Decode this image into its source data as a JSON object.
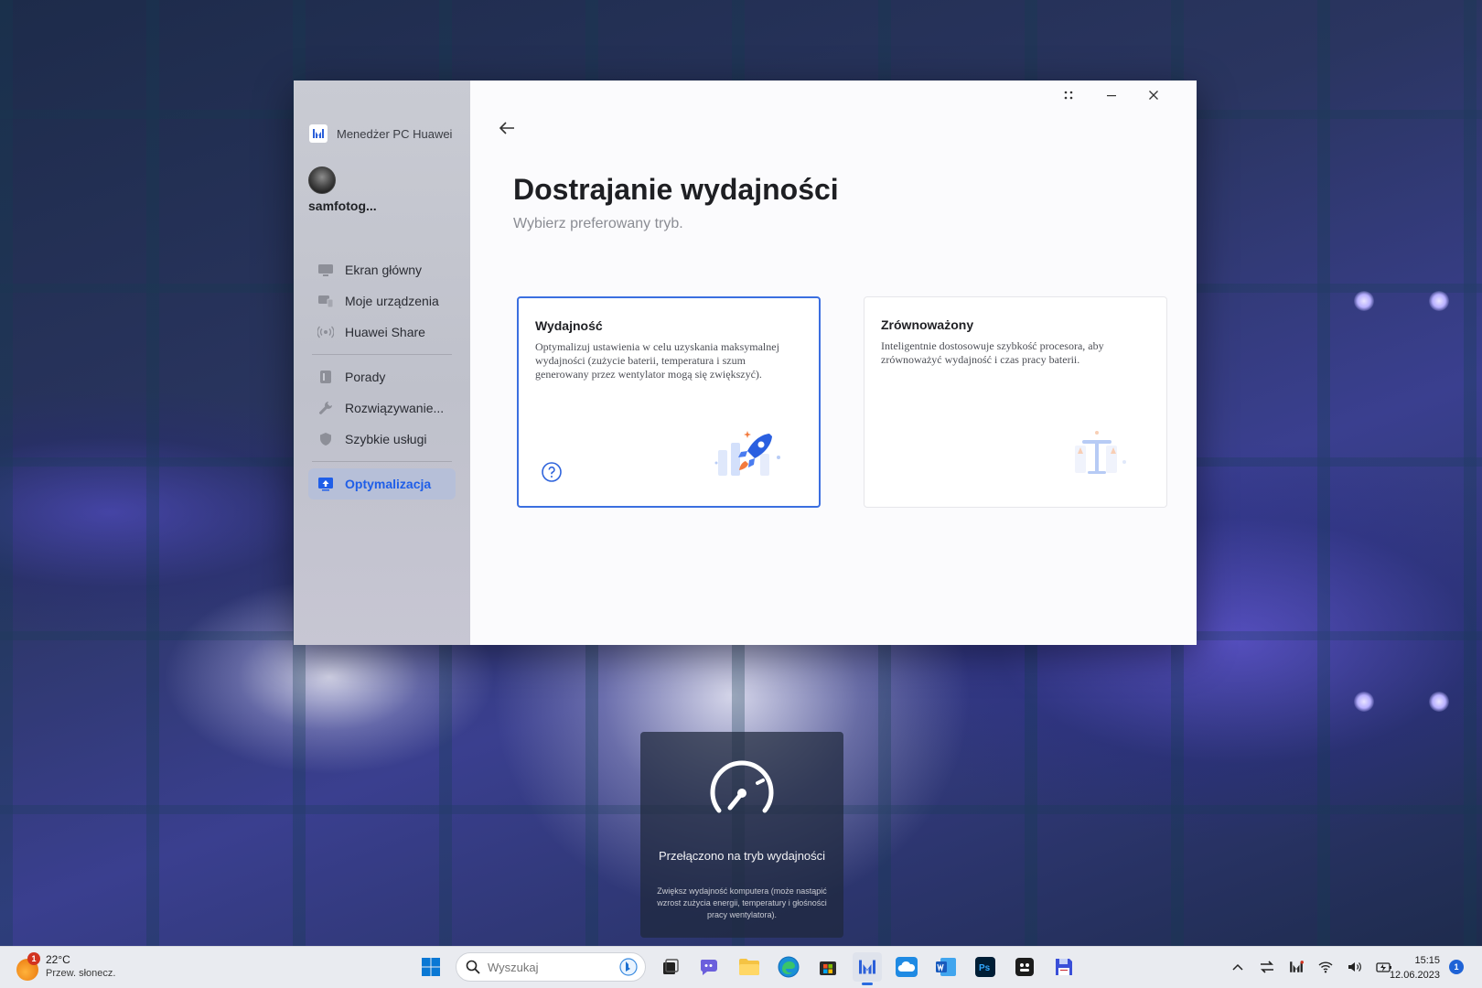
{
  "app": {
    "name": "Menedżer PC Huawei",
    "username": "samfotog...",
    "accent_color": "#3b6fe0"
  },
  "sidebar": {
    "items": [
      {
        "label": "Ekran główny",
        "icon": "monitor-icon"
      },
      {
        "label": "Moje urządzenia",
        "icon": "devices-icon"
      },
      {
        "label": "Huawei Share",
        "icon": "share-icon"
      },
      {
        "label": "Porady",
        "icon": "tips-icon"
      },
      {
        "label": "Rozwiązywanie...",
        "icon": "wrench-icon"
      },
      {
        "label": "Szybkie usługi",
        "icon": "shield-icon"
      },
      {
        "label": "Optymalizacja",
        "icon": "optimize-icon",
        "active": true
      }
    ]
  },
  "main": {
    "title": "Dostrajanie wydajności",
    "subtitle": "Wybierz preferowany tryb.",
    "modes": [
      {
        "title": "Wydajność",
        "description": "Optymalizuj ustawienia w celu uzyskania maksymalnej wydajności (zużycie baterii, temperatura i szum generowany przez wentylator mogą się zwiększyć).",
        "selected": true,
        "icon": "rocket-icon"
      },
      {
        "title": "Zrównoważony",
        "description": "Inteligentnie dostosowuje szybkość procesora, aby zrównoważyć wydajność i czas pracy baterii.",
        "selected": false,
        "icon": "balance-icon"
      }
    ]
  },
  "toast": {
    "title": "Przełączono na tryb wydajności",
    "description": "Zwiększ wydajność komputera (może nastąpić wzrost zużycia energii, temperatury i głośności pracy wentylatora).",
    "icon": "speedometer-icon"
  },
  "taskbar": {
    "weather_temp": "22°C",
    "weather_condition": "Przew. słonecz.",
    "weather_badge": "1",
    "search_placeholder": "Wyszukaj",
    "time": "15:15",
    "date": "12.06.2023",
    "notification_count": "1"
  }
}
